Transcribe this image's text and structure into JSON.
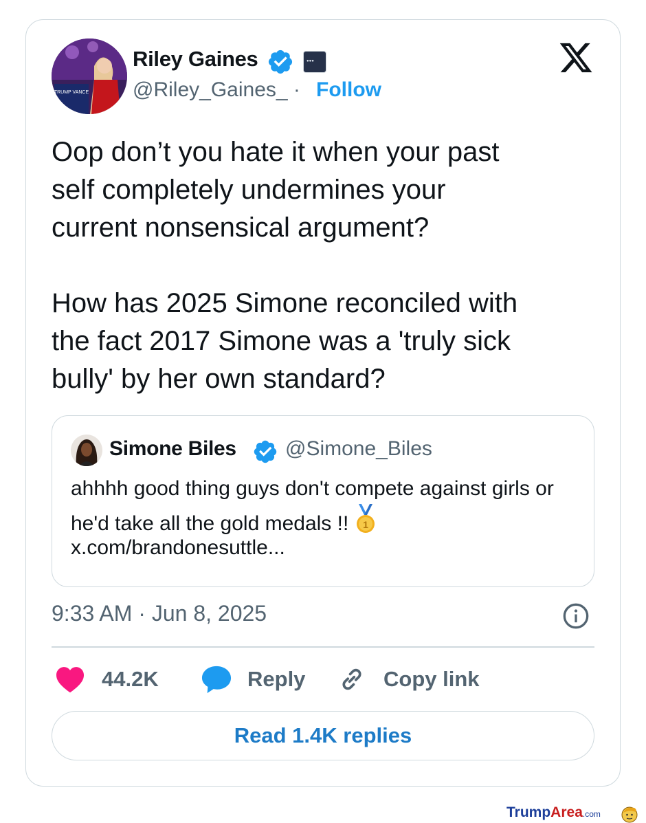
{
  "tweet": {
    "author": {
      "name": "Riley Gaines",
      "handle": "@Riley_Gaines_",
      "separator": "·",
      "follow_label": "Follow",
      "avatar_sign_text": "TRUMP VANCE"
    },
    "text": "Oop don’t you hate it when your past\nself completely undermines your\ncurrent nonsensical argument?\n\nHow has 2025 Simone reconciled with\nthe fact 2017 Simone was a 'truly sick\nbully' by her own standard?",
    "quote": {
      "name": "Simone Biles",
      "handle": "@Simone_Biles",
      "text": "ahhhh good thing guys don't compete against girls or he'd take all the gold medals !! ",
      "link": "x.com/brandonesuttle..."
    },
    "timestamp": "9:33 AM · Jun 8, 2025",
    "actions": {
      "likes": "44.2K",
      "reply_label": "Reply",
      "copy_label": "Copy link"
    },
    "read_replies_label": "Read 1.4K replies"
  },
  "watermark": {
    "part1": "Trump",
    "part2": "Area",
    "part3": ".com"
  },
  "colors": {
    "accent": "#1d9bf0",
    "heart": "#f91880",
    "secondary_text": "#536471",
    "border": "#cfd9de"
  },
  "icons": [
    "verified-badge-icon",
    "affiliate-badge-icon",
    "x-logo-icon",
    "info-icon",
    "heart-icon",
    "reply-bubble-icon",
    "link-icon",
    "gold-medal-icon"
  ]
}
